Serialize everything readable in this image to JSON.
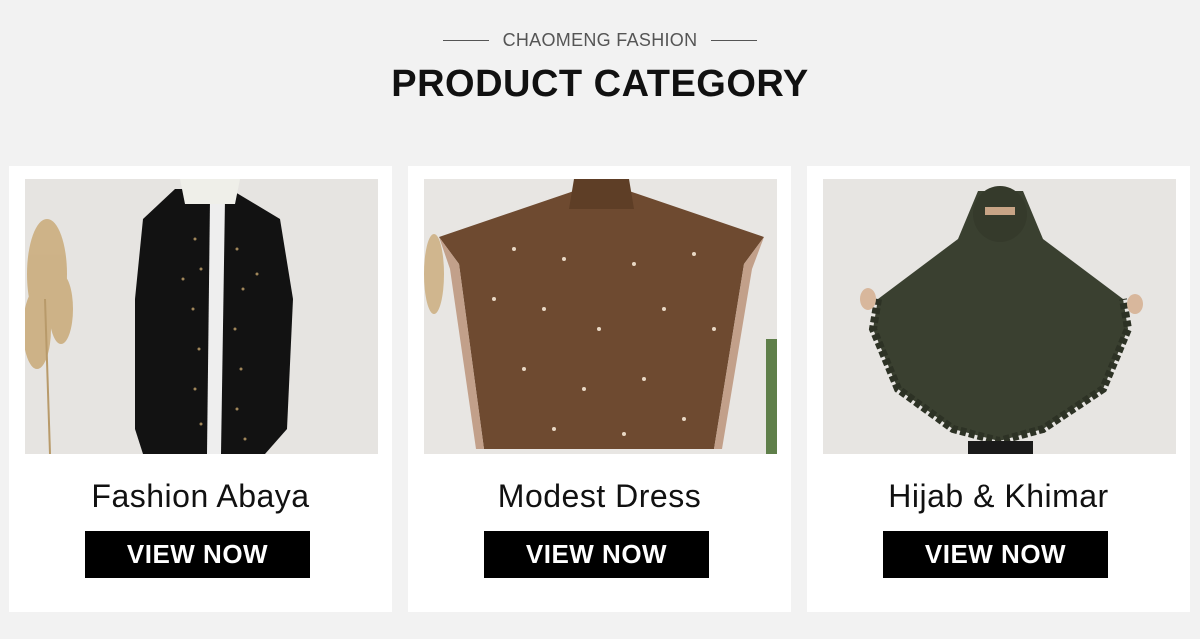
{
  "header": {
    "subtitle": "CHAOMENG FASHION",
    "title": "PRODUCT CATEGORY"
  },
  "cards": [
    {
      "name": "Fashion Abaya",
      "button": "VIEW NOW",
      "image_alt": "black abaya with gold beading"
    },
    {
      "name": "Modest Dress",
      "button": "VIEW NOW",
      "image_alt": "brown butterfly dress with pearls"
    },
    {
      "name": "Hijab & Khimar",
      "button": "VIEW NOW",
      "image_alt": "olive green khimar with ruffle trim"
    }
  ],
  "colors": {
    "page_background": "#f2f2f2",
    "card_background": "#ffffff",
    "button_background": "#000000",
    "button_text": "#ffffff",
    "abaya": "#121212",
    "dress": "#6e4a30",
    "khimar": "#3a4030"
  }
}
